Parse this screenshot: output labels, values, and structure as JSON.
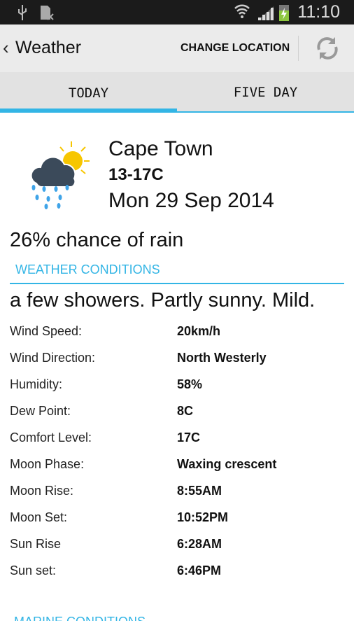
{
  "status_bar": {
    "time": "11:10",
    "icons": [
      "usb-icon",
      "sim-icon",
      "wifi-icon",
      "signal-icon",
      "battery-charging-icon"
    ]
  },
  "action_bar": {
    "title": "Weather",
    "change_location": "CHANGE LOCATION",
    "refresh_icon": "refresh-icon"
  },
  "tabs": [
    {
      "label": "TODAY",
      "active": true
    },
    {
      "label": "FIVE DAY",
      "active": false
    }
  ],
  "accent": "#33b5e5",
  "today": {
    "icon": "partly-sunny-showers-icon",
    "city": "Cape Town",
    "temp_range": "13-17C",
    "date": "Mon 29 Sep 2014",
    "rain_chance": "26% chance of rain",
    "section_title": "WEATHER CONDITIONS",
    "summary": "a few showers. Partly sunny. Mild.",
    "conditions": [
      {
        "label": "Wind Speed:",
        "value": "20km/h"
      },
      {
        "label": "Wind Direction:",
        "value": "North Westerly"
      },
      {
        "label": "Humidity:",
        "value": "58%"
      },
      {
        "label": "Dew Point:",
        "value": "8C"
      },
      {
        "label": "Comfort Level:",
        "value": "17C"
      },
      {
        "label": "Moon Phase:",
        "value": "Waxing crescent"
      },
      {
        "label": "Moon Rise:",
        "value": "8:55AM"
      },
      {
        "label": "Moon Set:",
        "value": "10:52PM"
      },
      {
        "label": "Sun Rise",
        "value": "6:28AM"
      },
      {
        "label": "Sun set:",
        "value": "6:46PM"
      }
    ],
    "next_section": "MARINE CONDITIONS"
  }
}
